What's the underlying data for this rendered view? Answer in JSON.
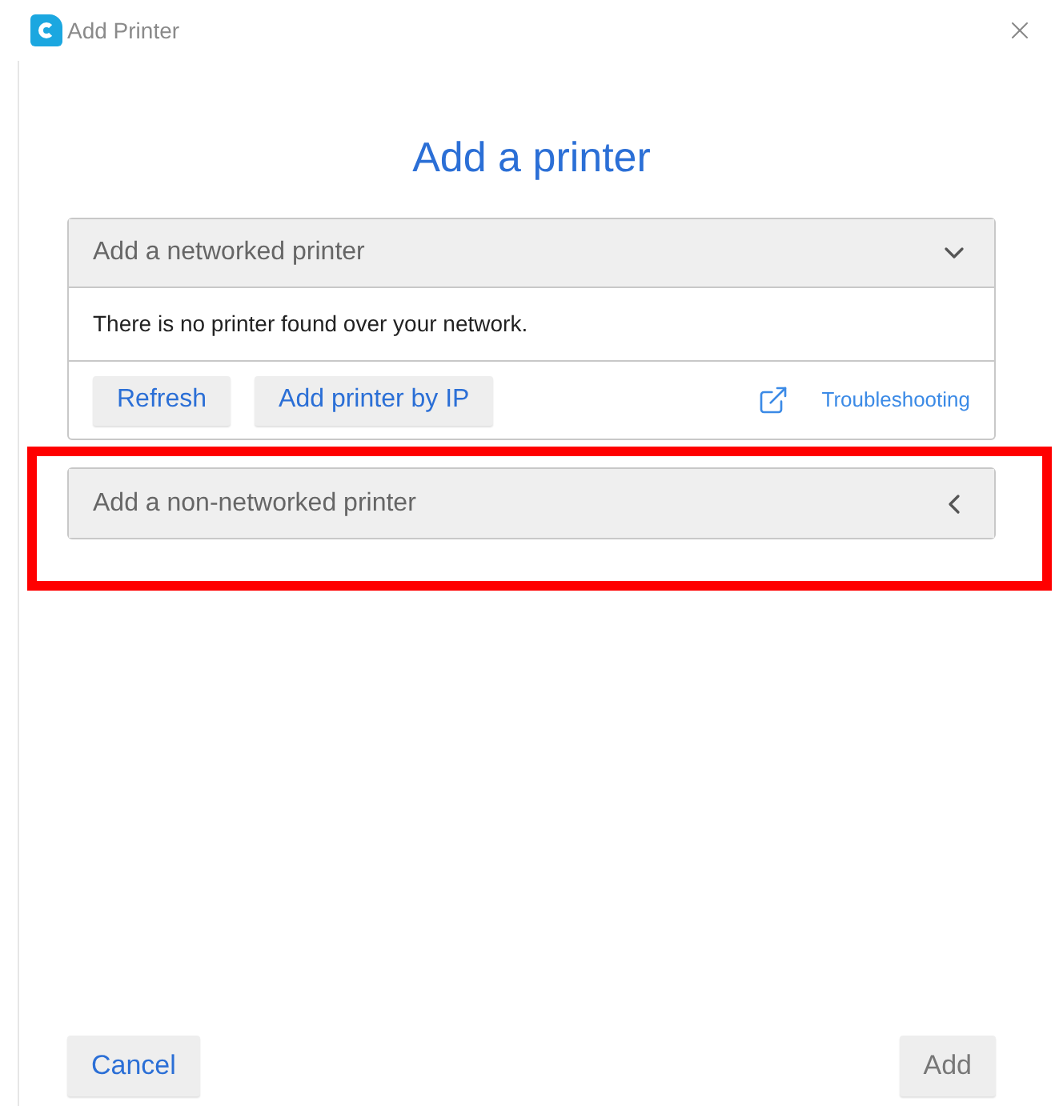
{
  "window": {
    "title": "Add Printer"
  },
  "heading": "Add a printer",
  "sections": [
    {
      "title": "Add a networked printer",
      "expanded": true,
      "message": "There is no printer found over your network.",
      "buttons": [
        "Refresh",
        "Add printer by IP"
      ],
      "link": "Troubleshooting",
      "highlighted": false
    },
    {
      "title": "Add a non-networked printer",
      "expanded": false,
      "highlighted": true
    }
  ],
  "footer": [
    {
      "label": "Cancel",
      "disabled": false
    },
    {
      "label": "Add",
      "disabled": true
    }
  ]
}
